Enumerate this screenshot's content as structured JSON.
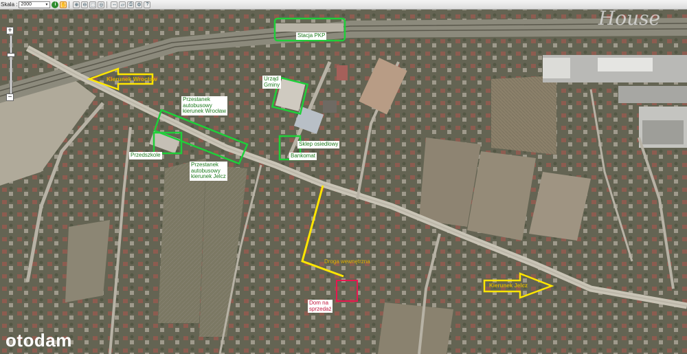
{
  "toolbar": {
    "scale_label": "Skala :",
    "scale_value": "2000",
    "info_icon": "info-icon",
    "tools": [
      "pan-hand-icon",
      "zoom-in-icon",
      "zoom-out-icon",
      "zoom-box-icon",
      "extent-icon",
      "distance-icon",
      "area-icon",
      "print-icon",
      "settings-icon",
      "help-icon"
    ]
  },
  "zoom": {
    "in_label": "+",
    "out_label": "−"
  },
  "labels": {
    "station": "Stacja PKP",
    "direction_west": "Kierunek Wrocław",
    "office": "Urząd\nGminy",
    "bus_stop_wroclaw": "Przestanek\nautobusowy\nkierunek Wrocław",
    "shop": "Sklep osiedlowy",
    "atm": "Bankomat",
    "kindergarten": "Przedszkole",
    "bus_stop_jelcz": "Przestanek\nautobusowy\nkierunek Jelcz",
    "inner_road": "Droga wewnętrzna",
    "house_for_sale": "Dom na\nsprzedaż",
    "direction_east": "Kierunek Jelcz"
  },
  "colors": {
    "highlight": "#1fcf3a",
    "road_marker": "#ffe600",
    "property": "#e8164e"
  },
  "watermark": "House",
  "brand": "otodam"
}
